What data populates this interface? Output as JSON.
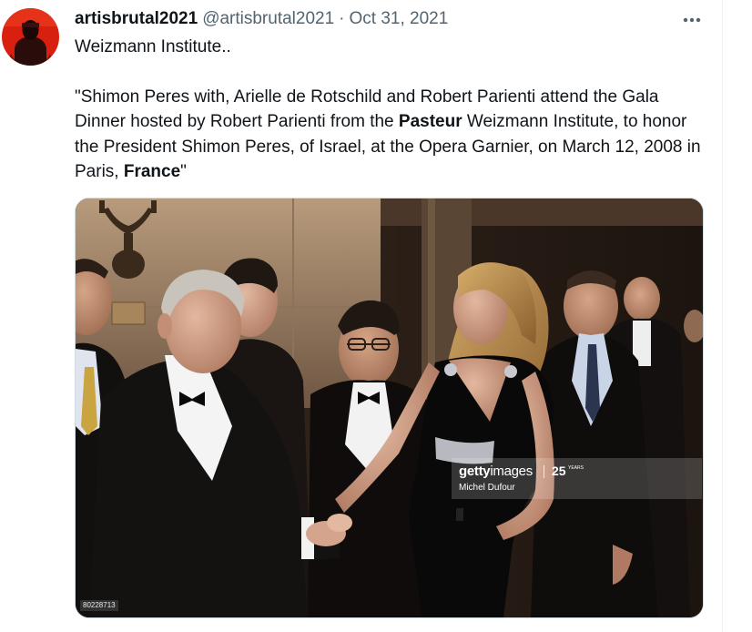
{
  "tweet": {
    "author": {
      "display_name": "artisbrutal2021",
      "handle": "@artisbrutal2021"
    },
    "separator": "·",
    "timestamp": "Oct 31, 2021",
    "text": {
      "line1": "Weizmann Institute..",
      "para_seg1": "\"Shimon Peres with, Arielle de Rotschild and Robert Parienti attend the Gala Dinner hosted by Robert Parienti from the ",
      "para_bold1": "Pasteur",
      "para_seg2": " Weizmann Institute, to honor the President Shimon Peres, of Israel, at the Opera Garnier, on March 12, 2008 in Paris, ",
      "para_bold2": "France",
      "para_seg3": "\""
    },
    "media": {
      "watermark_brand_bold": "getty",
      "watermark_brand_light": "images",
      "watermark_anniversary_number": "25",
      "watermark_anniversary_label": "YEARS",
      "watermark_credit": "Michel Dufour",
      "image_id": "80228713"
    }
  },
  "icons": {
    "more": "more-horizontal-icon",
    "avatar": "red-portrait-avatar"
  },
  "colors": {
    "name_text": "#0f1419",
    "secondary_text": "#536471",
    "avatar_red": "#d91f10"
  }
}
